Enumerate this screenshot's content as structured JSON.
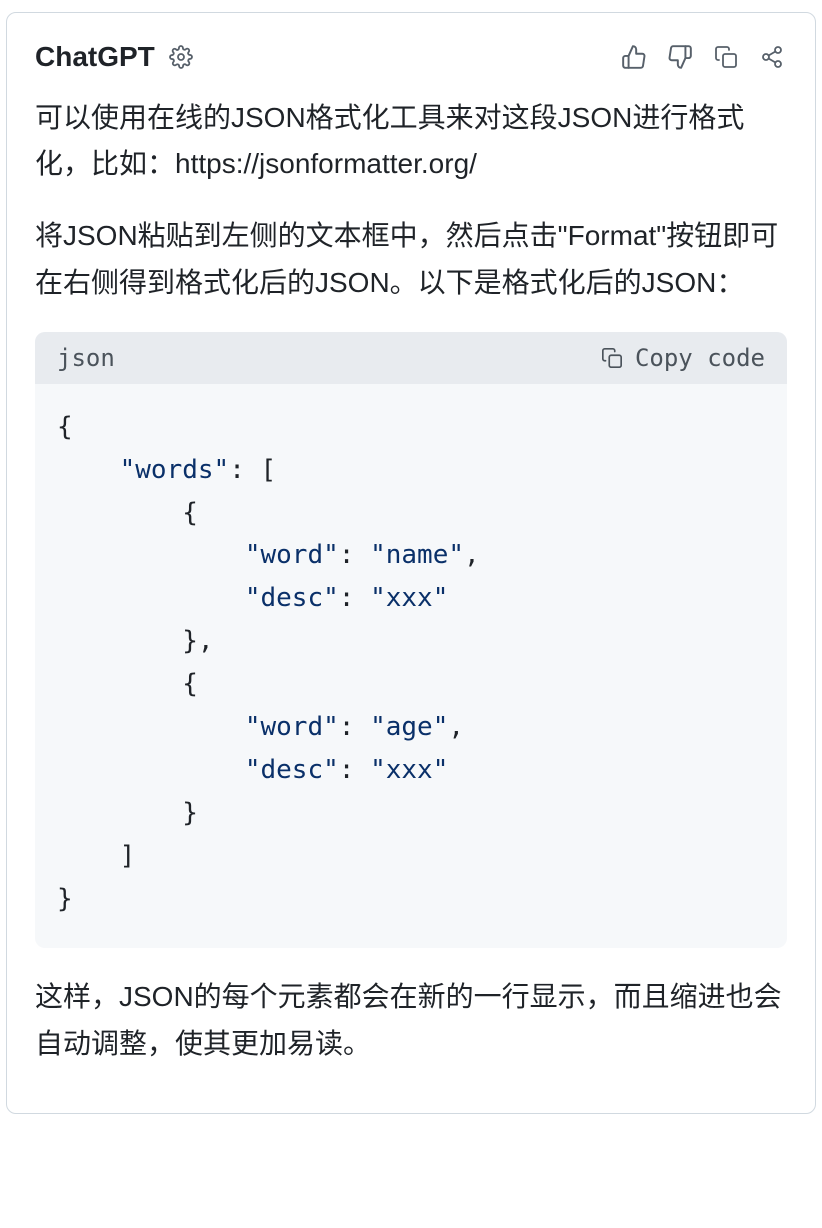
{
  "header": {
    "bot_name": "ChatGPT"
  },
  "paragraphs": {
    "p1": "可以使用在线的JSON格式化工具来对这段JSON进行格式化，比如：https://jsonformatter.org/",
    "p2": "将JSON粘贴到左侧的文本框中，然后点击\"Format\"按钮即可在右侧得到格式化后的JSON。以下是格式化后的JSON：",
    "p3": "这样，JSON的每个元素都会在新的一行显示，而且缩进也会自动调整，使其更加易读。"
  },
  "code": {
    "lang": "json",
    "copy_label": "Copy code",
    "content_plain": "{\n    \"words\": [\n        {\n            \"word\": \"name\",\n            \"desc\": \"xxx\"\n        },\n        {\n            \"word\": \"age\",\n            \"desc\": \"xxx\"\n        }\n    ]\n}",
    "tokens": [
      [
        "punc",
        "{"
      ],
      [
        "nl",
        ""
      ],
      [
        "indent",
        "    "
      ],
      [
        "key",
        "\"words\""
      ],
      [
        "punc",
        ": ["
      ],
      [
        "nl",
        ""
      ],
      [
        "indent",
        "        "
      ],
      [
        "punc",
        "{"
      ],
      [
        "nl",
        ""
      ],
      [
        "indent",
        "            "
      ],
      [
        "key",
        "\"word\""
      ],
      [
        "punc",
        ": "
      ],
      [
        "str",
        "\"name\""
      ],
      [
        "punc",
        ","
      ],
      [
        "nl",
        ""
      ],
      [
        "indent",
        "            "
      ],
      [
        "key",
        "\"desc\""
      ],
      [
        "punc",
        ": "
      ],
      [
        "str",
        "\"xxx\""
      ],
      [
        "nl",
        ""
      ],
      [
        "indent",
        "        "
      ],
      [
        "punc",
        "},"
      ],
      [
        "nl",
        ""
      ],
      [
        "indent",
        "        "
      ],
      [
        "punc",
        "{"
      ],
      [
        "nl",
        ""
      ],
      [
        "indent",
        "            "
      ],
      [
        "key",
        "\"word\""
      ],
      [
        "punc",
        ": "
      ],
      [
        "str",
        "\"age\""
      ],
      [
        "punc",
        ","
      ],
      [
        "nl",
        ""
      ],
      [
        "indent",
        "            "
      ],
      [
        "key",
        "\"desc\""
      ],
      [
        "punc",
        ": "
      ],
      [
        "str",
        "\"xxx\""
      ],
      [
        "nl",
        ""
      ],
      [
        "indent",
        "        "
      ],
      [
        "punc",
        "}"
      ],
      [
        "nl",
        ""
      ],
      [
        "indent",
        "    "
      ],
      [
        "punc",
        "]"
      ],
      [
        "nl",
        ""
      ],
      [
        "punc",
        "}"
      ]
    ]
  }
}
